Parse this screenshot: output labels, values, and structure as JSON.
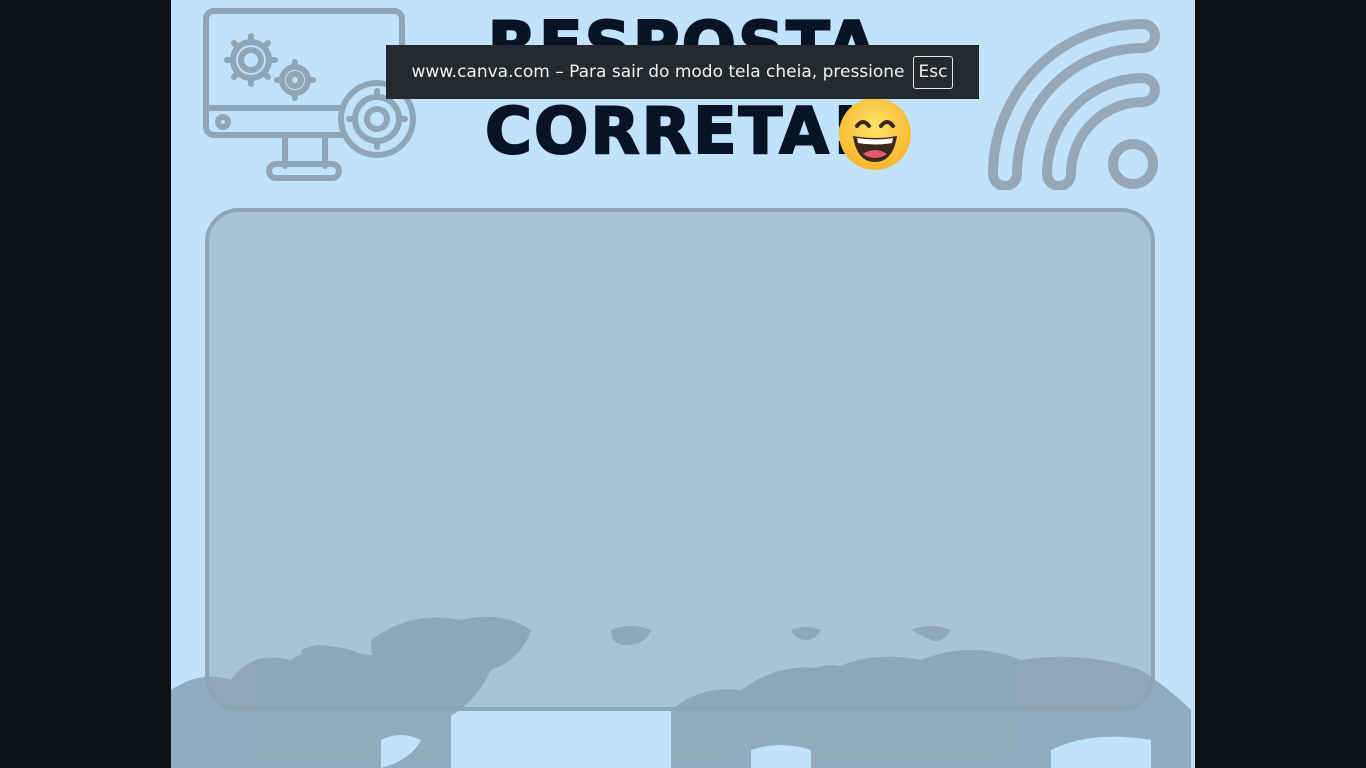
{
  "slide": {
    "title_line1": "RESPOSTA",
    "title_line2": "CORRETA!",
    "emoji": "grinning-face-emoji",
    "background_color": "#c0e2fc",
    "panel_color": "#a8c3d6",
    "title_color": "#081425"
  },
  "fullscreen_notice": {
    "message": "www.canva.com – Para sair do modo tela cheia, pressione",
    "key": "Esc"
  },
  "icons": [
    "computer-gears-icon",
    "wifi-icon",
    "world-map-graphic"
  ]
}
